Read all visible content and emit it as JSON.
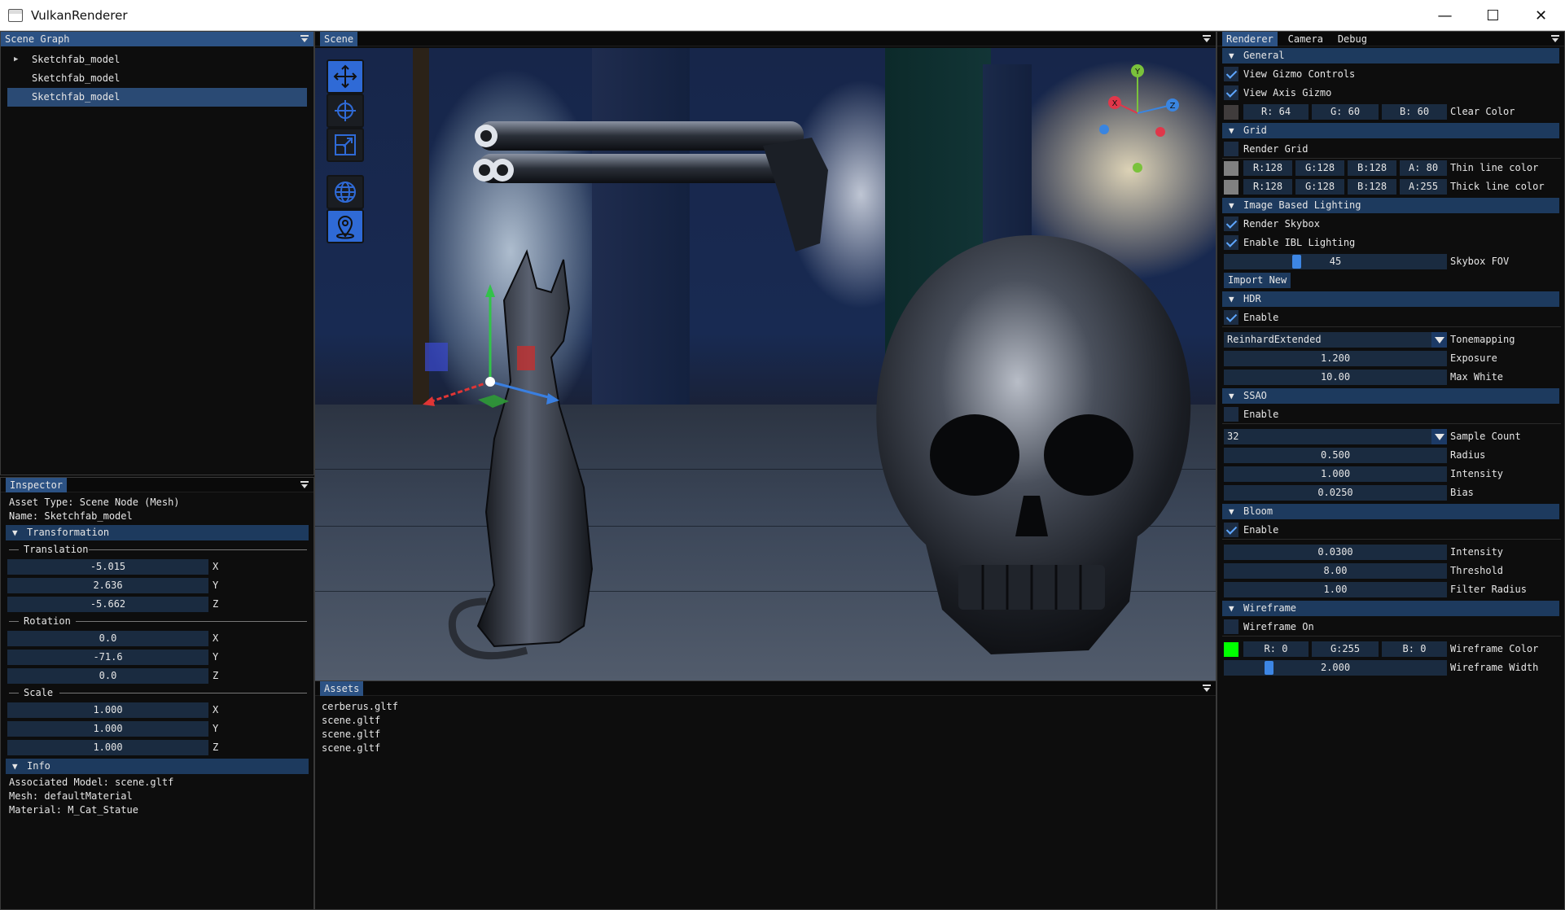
{
  "window": {
    "title": "VulkanRenderer",
    "minimize": "—",
    "maximize": "☐",
    "close": "✕"
  },
  "scene_graph": {
    "tab": "Scene Graph",
    "items": [
      {
        "label": "Sketchfab_model",
        "arrow": "▶"
      },
      {
        "label": "Sketchfab_model"
      },
      {
        "label": "Sketchfab_model"
      }
    ]
  },
  "inspector": {
    "tab": "Inspector",
    "asset_type": "Asset Type: Scene Node (Mesh)",
    "name": "Name: Sketchfab_model",
    "transformation": {
      "header": "Transformation",
      "translation": {
        "label": "Translation",
        "x": "-5.015",
        "y": "2.636",
        "z": "-5.662"
      },
      "rotation": {
        "label": "Rotation",
        "x": "0.0",
        "y": "-71.6",
        "z": "0.0"
      },
      "scale": {
        "label": "Scale",
        "x": "1.000",
        "y": "1.000",
        "z": "1.000"
      },
      "axes": {
        "x": "X",
        "y": "Y",
        "z": "Z"
      }
    },
    "info": {
      "header": "Info",
      "model": "Associated Model: scene.gltf",
      "mesh": "Mesh: defaultMaterial",
      "material": "Material: M_Cat_Statue"
    }
  },
  "scene": {
    "tab": "Scene",
    "toolbar": [
      "translate-icon",
      "rotate-icon",
      "scale-icon",
      "globe-icon",
      "location-pin-icon"
    ],
    "axis_gizmo": {
      "x": "X",
      "y": "Y",
      "z": "Z"
    }
  },
  "assets": {
    "tab": "Assets",
    "files": [
      "cerberus.gltf",
      "scene.gltf",
      "scene.gltf",
      "scene.gltf"
    ]
  },
  "renderer": {
    "tabs": [
      "Renderer",
      "Camera",
      "Debug"
    ],
    "general": {
      "header": "General",
      "view_gizmo_controls": "View Gizmo Controls",
      "view_axis_gizmo": "View Axis Gizmo",
      "clear_color": {
        "r": "R: 64",
        "g": "G: 60",
        "b": "B: 60",
        "label": "Clear Color",
        "swatch": "#403c3c"
      }
    },
    "grid": {
      "header": "Grid",
      "render_grid": "Render Grid",
      "thin": {
        "r": "R:128",
        "g": "G:128",
        "b": "B:128",
        "a": "A: 80",
        "label": "Thin line color",
        "swatch": "#808080"
      },
      "thick": {
        "r": "R:128",
        "g": "G:128",
        "b": "B:128",
        "a": "A:255",
        "label": "Thick line color",
        "swatch": "#808080"
      }
    },
    "ibl": {
      "header": "Image Based Lighting",
      "render_skybox": "Render Skybox",
      "enable_ibl": "Enable IBL Lighting",
      "skybox_fov": {
        "value": "45",
        "label": "Skybox FOV",
        "fraction": 0.32
      },
      "import_new": "Import New"
    },
    "hdr": {
      "header": "HDR",
      "enable": "Enable",
      "tonemapping": {
        "value": "ReinhardExtended",
        "label": "Tonemapping"
      },
      "exposure": {
        "value": "1.200",
        "label": "Exposure"
      },
      "max_white": {
        "value": "10.00",
        "label": "Max White"
      }
    },
    "ssao": {
      "header": "SSAO",
      "enable": "Enable",
      "sample_count": {
        "value": "32",
        "label": "Sample Count"
      },
      "radius": {
        "value": "0.500",
        "label": "Radius"
      },
      "intensity": {
        "value": "1.000",
        "label": "Intensity"
      },
      "bias": {
        "value": "0.0250",
        "label": "Bias"
      }
    },
    "bloom": {
      "header": "Bloom",
      "enable": "Enable",
      "intensity": {
        "value": "0.0300",
        "label": "Intensity"
      },
      "threshold": {
        "value": "8.00",
        "label": "Threshold"
      },
      "filter_radius": {
        "value": "1.00",
        "label": "Filter Radius"
      }
    },
    "wireframe": {
      "header": "Wireframe",
      "on": "Wireframe On",
      "color": {
        "r": "R: 0",
        "g": "G:255",
        "b": "B: 0",
        "label": "Wireframe Color",
        "swatch": "#00ff00"
      },
      "width": {
        "value": "2.000",
        "label": "Wireframe Width",
        "fraction": 0.2
      }
    }
  },
  "colors": {
    "accent": "#2c5284",
    "header": "#1d3a5e",
    "frame": "#1a2b40",
    "check": "#5fa7ff"
  }
}
